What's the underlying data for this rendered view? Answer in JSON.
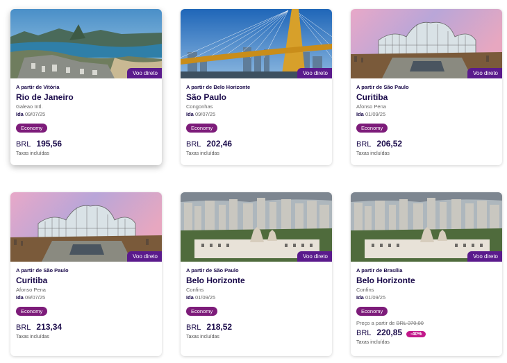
{
  "badge_label": "Voo direto",
  "ida_label": "Ida",
  "taxes_label": "Taxas incluídas",
  "cards": [
    {
      "from": "A partir de Vitória",
      "city": "Rio de Janeiro",
      "airport": "Galeao Intl.",
      "date": "09/07/25",
      "cabin": "Economy",
      "currency": "BRL",
      "price": "195,56",
      "image": "rio-de-janeiro-photo"
    },
    {
      "from": "A partir de Belo Horizonte",
      "city": "São Paulo",
      "airport": "Congonhas",
      "date": "09/07/25",
      "cabin": "Economy",
      "currency": "BRL",
      "price": "202,46",
      "image": "sao-paulo-bridge-photo"
    },
    {
      "from": "A partir de São Paulo",
      "city": "Curitiba",
      "airport": "Afonso Pena",
      "date": "01/09/25",
      "cabin": "Economy",
      "currency": "BRL",
      "price": "206,52",
      "image": "curitiba-botanical-garden-photo"
    },
    {
      "from": "A partir de São Paulo",
      "city": "Curitiba",
      "airport": "Afonso Pena",
      "date": "09/07/25",
      "cabin": "Economy",
      "currency": "BRL",
      "price": "213,34",
      "image": "curitiba-botanical-garden-photo"
    },
    {
      "from": "A partir de São Paulo",
      "city": "Belo Horizonte",
      "airport": "Confins",
      "date": "01/09/25",
      "cabin": "Economy",
      "currency": "BRL",
      "price": "218,52",
      "image": "belo-horizonte-city-photo"
    },
    {
      "from": "A partir de Brasília",
      "city": "Belo Horizonte",
      "airport": "Confins",
      "date": "01/09/25",
      "cabin": "Economy",
      "currency": "BRL",
      "price": "220,85",
      "image": "belo-horizonte-city-photo",
      "old_price_prefix": "Preço a partir de",
      "old_price": "BRL 370,00",
      "discount": "-40%"
    }
  ],
  "colors": {
    "brand_purple": "#5a1a8c",
    "chip_magenta": "#7d1c7a",
    "discount_pink": "#c2188a",
    "text_navy": "#1a0a4a"
  }
}
